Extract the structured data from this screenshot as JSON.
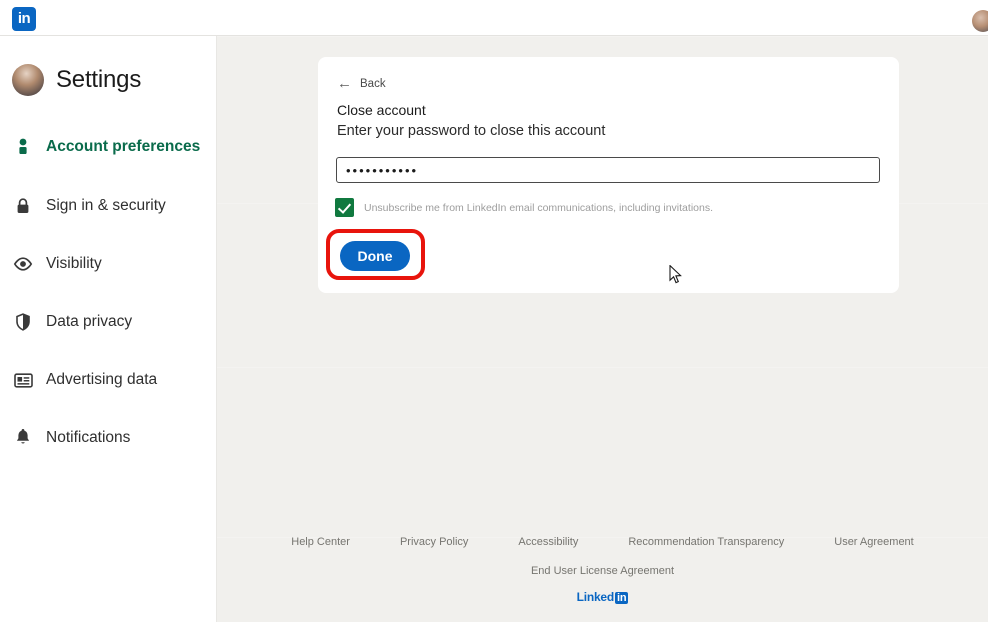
{
  "header": {
    "logo_text": "in",
    "avatar_name": "user-avatar"
  },
  "sidebar": {
    "title": "Settings",
    "items": [
      {
        "label": "Account preferences",
        "icon": "person-icon",
        "active": true
      },
      {
        "label": "Sign in & security",
        "icon": "lock-icon",
        "active": false
      },
      {
        "label": "Visibility",
        "icon": "eye-icon",
        "active": false
      },
      {
        "label": "Data privacy",
        "icon": "shield-icon",
        "active": false
      },
      {
        "label": "Advertising data",
        "icon": "ad-card-icon",
        "active": false
      },
      {
        "label": "Notifications",
        "icon": "bell-icon",
        "active": false
      }
    ]
  },
  "card": {
    "back_label": "Back",
    "title": "Close account",
    "subtitle": "Enter your password to close this account",
    "password_value": "•••••••••••",
    "password_placeholder": "",
    "unsubscribe_label": "Unsubscribe me from LinkedIn email communications, including invitations.",
    "unsubscribe_checked": "true",
    "done_label": "Done"
  },
  "annotation": {
    "highlight_color": "#e8140c",
    "highlight_target": "done-button"
  },
  "colors": {
    "brand_blue": "#0a66c2",
    "active_green": "#0a6b4b",
    "checkbox_green": "#10793f",
    "page_background": "#f1f0ed",
    "card_background": "#ffffff"
  },
  "footer": {
    "links": [
      "Help Center",
      "Privacy Policy",
      "Accessibility",
      "Recommendation Transparency",
      "User Agreement"
    ],
    "eula": "End User License Agreement",
    "logo_text": "Linked",
    "logo_badge": "in"
  }
}
